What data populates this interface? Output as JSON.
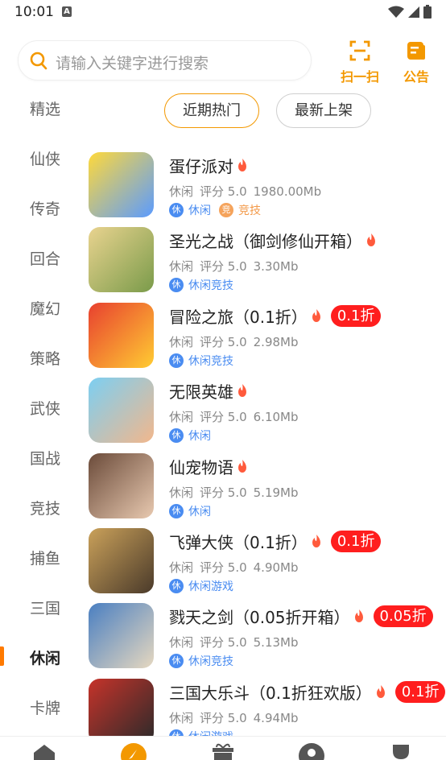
{
  "status_bar": {
    "time": "10:01",
    "notif_badge": "A"
  },
  "search": {
    "placeholder": "请输入关键字进行搜索"
  },
  "header_buttons": {
    "scan_label": "扫一扫",
    "notice_label": "公告"
  },
  "accent_color": "#f39800",
  "categories": [
    {
      "label": "精选"
    },
    {
      "label": "仙侠"
    },
    {
      "label": "传奇"
    },
    {
      "label": "回合"
    },
    {
      "label": "魔幻"
    },
    {
      "label": "策略"
    },
    {
      "label": "武侠"
    },
    {
      "label": "国战"
    },
    {
      "label": "竞技"
    },
    {
      "label": "捕鱼"
    },
    {
      "label": "三国"
    },
    {
      "label": "休闲"
    },
    {
      "label": "卡牌"
    }
  ],
  "active_category": "休闲",
  "tabs": {
    "hot": "近期热门",
    "new": "最新上架"
  },
  "games": [
    {
      "title": "蛋仔派对",
      "discount": "",
      "genre": "休闲",
      "score": "评分 5.0",
      "size": "1980.00Mb",
      "tags": [
        {
          "badge": "休",
          "text": "休闲",
          "color": "blue"
        },
        {
          "badge": "竞",
          "text": "竞技",
          "color": "orange"
        }
      ]
    },
    {
      "title": "圣光之战（御剑修仙开箱）",
      "discount": "",
      "genre": "休闲",
      "score": "评分 5.0",
      "size": "3.30Mb",
      "tags": [
        {
          "badge": "休",
          "text": "休闲竞技",
          "color": "blue"
        }
      ]
    },
    {
      "title": "冒险之旅（0.1折）",
      "discount": "0.1折",
      "genre": "休闲",
      "score": "评分 5.0",
      "size": "2.98Mb",
      "tags": [
        {
          "badge": "休",
          "text": "休闲竞技",
          "color": "blue"
        }
      ]
    },
    {
      "title": "无限英雄",
      "discount": "",
      "genre": "休闲",
      "score": "评分 5.0",
      "size": "6.10Mb",
      "tags": [
        {
          "badge": "休",
          "text": "休闲",
          "color": "blue"
        }
      ]
    },
    {
      "title": "仙宠物语",
      "discount": "",
      "genre": "休闲",
      "score": "评分 5.0",
      "size": "5.19Mb",
      "tags": [
        {
          "badge": "休",
          "text": "休闲",
          "color": "blue"
        }
      ]
    },
    {
      "title": "飞弹大侠（0.1折）",
      "discount": "0.1折",
      "genre": "休闲",
      "score": "评分 5.0",
      "size": "4.90Mb",
      "tags": [
        {
          "badge": "休",
          "text": "休闲游戏",
          "color": "blue"
        }
      ]
    },
    {
      "title": "戮天之剑（0.05折开箱）",
      "discount": "0.05折",
      "genre": "休闲",
      "score": "评分 5.0",
      "size": "5.13Mb",
      "tags": [
        {
          "badge": "休",
          "text": "休闲竞技",
          "color": "blue"
        }
      ]
    },
    {
      "title": "三国大乐斗（0.1折狂欢版）",
      "discount": "0.1折",
      "genre": "休闲",
      "score": "评分 5.0",
      "size": "4.94Mb",
      "tags": [
        {
          "badge": "休",
          "text": "休闲游戏",
          "color": "blue"
        }
      ]
    }
  ]
}
